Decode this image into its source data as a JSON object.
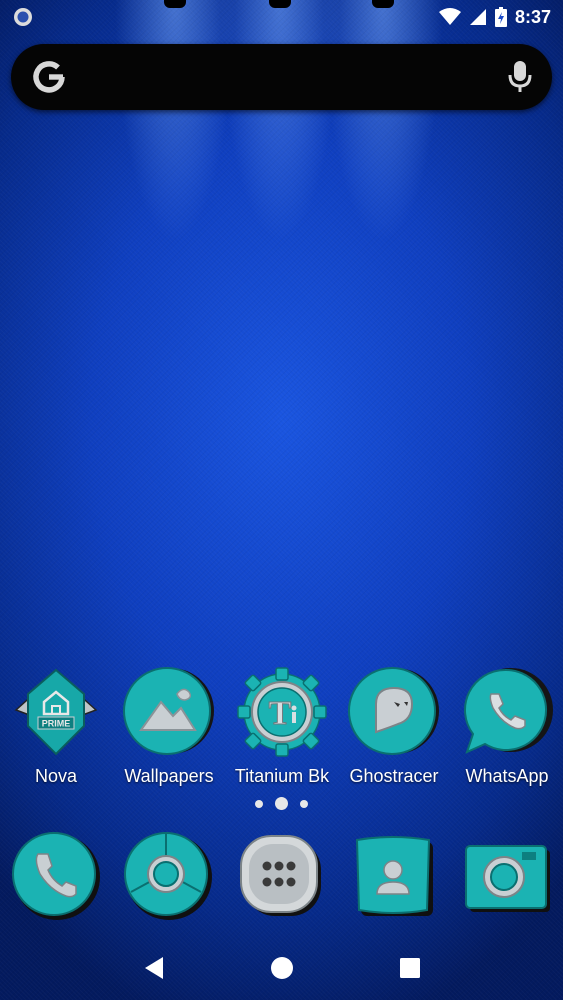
{
  "status_bar": {
    "time": "8:37",
    "icons": [
      "notification-dot-icon",
      "wifi-icon",
      "signal-icon",
      "battery-charging-icon"
    ]
  },
  "search_bar": {
    "logo_text": "G",
    "icons": [
      "google-logo",
      "mic-icon"
    ]
  },
  "home_apps": [
    {
      "label": "Nova",
      "icon": "nova-prime-icon"
    },
    {
      "label": "Wallpapers",
      "icon": "wallpapers-icon"
    },
    {
      "label": "Titanium Bk",
      "icon": "titanium-backup-icon"
    },
    {
      "label": "Ghostracer",
      "icon": "ghost-icon"
    },
    {
      "label": "WhatsApp",
      "icon": "whatsapp-icon"
    }
  ],
  "nova_badge_text": "PRIME",
  "titanium_glyph": "T",
  "page_indicator": {
    "pages": 3,
    "current": 2
  },
  "dock": [
    {
      "icon": "phone-icon"
    },
    {
      "icon": "chrome-icon"
    },
    {
      "icon": "app-drawer-icon"
    },
    {
      "icon": "contacts-icon"
    },
    {
      "icon": "camera-icon"
    }
  ],
  "nav_bar": {
    "icons": [
      "back-icon",
      "home-icon",
      "recents-icon"
    ]
  },
  "colors": {
    "teal": "#1bb3b3",
    "teal_dark": "#0d7f80",
    "silver": "#c9cfd3",
    "background_blue": "#0f3fc0"
  }
}
